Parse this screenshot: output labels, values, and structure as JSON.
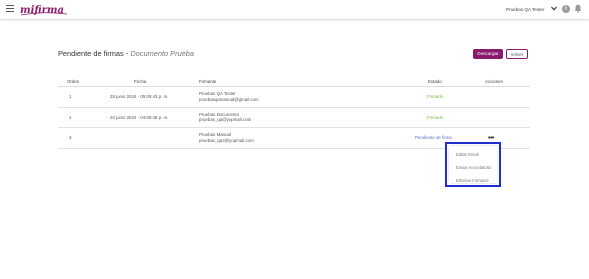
{
  "header": {
    "brand": "mifirma",
    "user": "Pruebas QA Tester"
  },
  "page": {
    "title": "Pendiente de firmas",
    "separator": "-",
    "document_name": "Documento Prueba",
    "download_label": "Descargar",
    "back_label": "Volver"
  },
  "table": {
    "headers": {
      "orden": "Orden",
      "fecha": "Fecha",
      "firmante": "Firmante",
      "estado": "Estado",
      "acciones": "Acciones"
    },
    "rows": [
      {
        "orden": "1",
        "fecha": "28 junio 2024 - 05:09:43 p. m.",
        "name": "Pruebas QA Tester",
        "email": "pruebasqamanual@gmail.com",
        "estado": "Firmado"
      },
      {
        "orden": "2",
        "fecha": "20 junio 2024 - 04:06:48 p. m.",
        "name": "Pruebas Documento",
        "email": "pruebas_qa@yopmail.com",
        "estado": "Firmado"
      },
      {
        "orden": "3",
        "fecha": "",
        "name": "Pruebas Manual",
        "email": "pruebas_qa3@yopmail.com",
        "estado": "Pendiente de firma"
      }
    ],
    "actions_icon": "more-horizontal-icon"
  },
  "menu": {
    "items": [
      "Editar Email",
      "Enviar recordatorio",
      "Eliminar Firmante"
    ]
  },
  "colors": {
    "brand": "#8a1a6b",
    "firmado": "#7cb342",
    "pendiente": "#5a6fbf",
    "highlight": "#1f2ecc"
  }
}
